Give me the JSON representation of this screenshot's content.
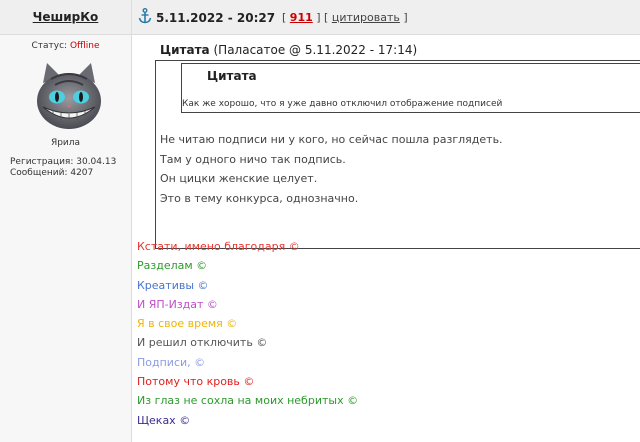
{
  "post": {
    "username": "ЧеширКо",
    "datetime": "5.11.2022 - 20:27",
    "post_number": "911",
    "quote_action": "цитировать"
  },
  "profile": {
    "status_label": "Статус:",
    "status_value": "Offline",
    "rank": "Ярила",
    "registration": "Регистрация: 30.04.13",
    "messages": "Сообщений: 4207",
    "avatar_icon": "cheshire-cat-avatar"
  },
  "quote": {
    "title": "Цитата",
    "meta": "(Паласатое @ 5.11.2022 - 17:14)",
    "inner": {
      "title": "Цитата",
      "text": "Как же хорошо, что я уже давно отключил отображение подписей"
    },
    "lines": [
      "Не читаю подписи ни у кого, но сейчас пошла разглядеть.",
      "Там у одного ничо так подпись.",
      "Он цицки женские целует.",
      "Это в тему конкурса, однозначно."
    ]
  },
  "poem": [
    {
      "text": "Кстати, имено благодаря ©",
      "color": "#e8332c"
    },
    {
      "text": "Разделам ©",
      "color": "#2c9a2c"
    },
    {
      "text": "Креативы ©",
      "color": "#4a74cc"
    },
    {
      "text": "И ЯП-Издат ©",
      "color": "#c04ec8"
    },
    {
      "text": "Я в свое время ©",
      "color": "#f0b400"
    },
    {
      "text": "И решил отключить ©",
      "color": "#555555"
    },
    {
      "text": "Подписи, ©",
      "color": "#8c9ce4"
    },
    {
      "text": "Потому что кровь ©",
      "color": "#e02020"
    },
    {
      "text": "Из глаз не сохла на моих небритых ©",
      "color": "#2c9a2c"
    },
    {
      "text": "Щеках ©",
      "color": "#3a2c8c"
    }
  ]
}
